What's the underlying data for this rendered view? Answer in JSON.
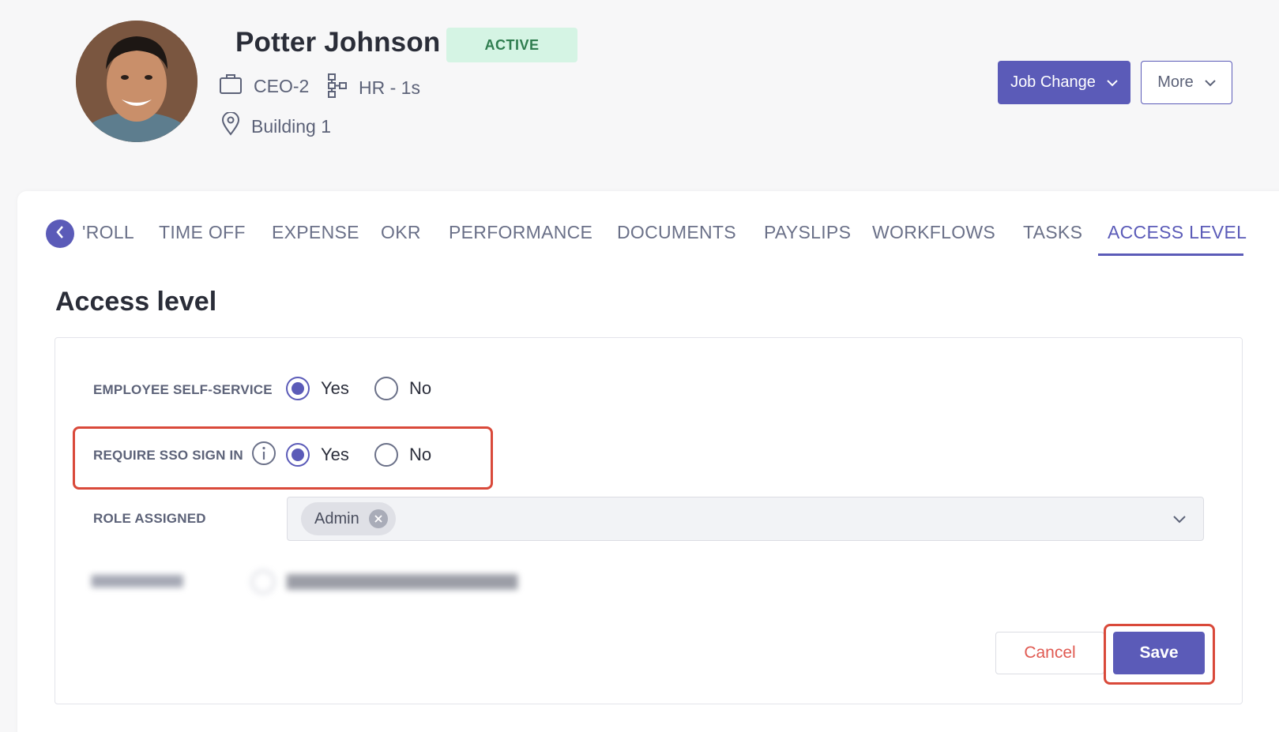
{
  "profile": {
    "name": "Potter Johnson",
    "status": "ACTIVE",
    "role": "CEO-2",
    "department": "HR - 1s",
    "location": "Building 1"
  },
  "actions": {
    "job_change_label": "Job Change",
    "more_label": "More"
  },
  "tabs": [
    {
      "label": "'ROLL",
      "active": false
    },
    {
      "label": "TIME OFF",
      "active": false
    },
    {
      "label": "EXPENSE",
      "active": false
    },
    {
      "label": "OKR",
      "active": false
    },
    {
      "label": "PERFORMANCE",
      "active": false
    },
    {
      "label": "DOCUMENTS",
      "active": false
    },
    {
      "label": "PAYSLIPS",
      "active": false
    },
    {
      "label": "WORKFLOWS",
      "active": false
    },
    {
      "label": "TASKS",
      "active": false
    },
    {
      "label": "ACCESS LEVEL",
      "active": true
    }
  ],
  "section": {
    "title": "Access level"
  },
  "form": {
    "employee_self_service": {
      "label": "EMPLOYEE SELF-SERVICE",
      "yes": "Yes",
      "no": "No",
      "selected": "Yes"
    },
    "require_sso": {
      "label": "REQUIRE SSO SIGN IN",
      "yes": "Yes",
      "no": "No",
      "selected": "Yes"
    },
    "role_assigned": {
      "label": "ROLE ASSIGNED",
      "chips": [
        "Admin"
      ]
    },
    "cancel_label": "Cancel",
    "save_label": "Save"
  },
  "colors": {
    "accent": "#5b5bb8",
    "active_badge_bg": "#d5f4e4",
    "active_badge_text": "#2f7d4f",
    "highlight": "#d9493a",
    "cancel_text": "#e05a52"
  },
  "icons": [
    "chevron-left-icon",
    "briefcase-icon",
    "org-chart-icon",
    "location-pin-icon",
    "chevron-down-icon",
    "info-icon",
    "close-icon"
  ]
}
